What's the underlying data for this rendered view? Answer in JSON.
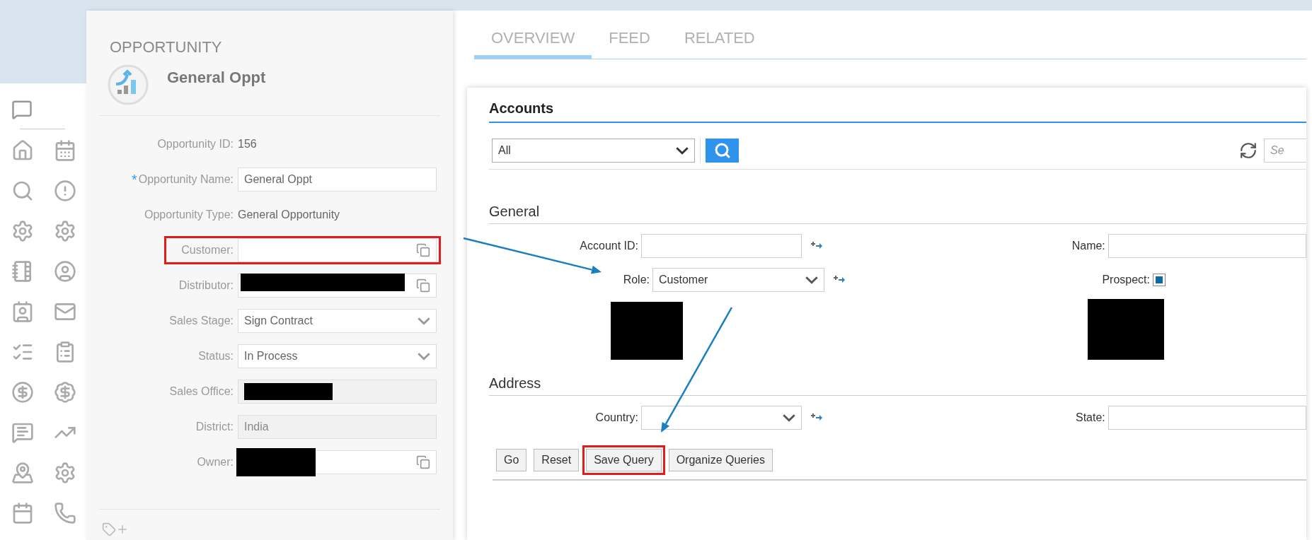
{
  "record": {
    "type_label": "OPPORTUNITY",
    "name": "General Oppt"
  },
  "required_marker": "*",
  "fields": [
    {
      "label": "Opportunity ID:",
      "kind": "text",
      "value": "156",
      "required": false,
      "redacted": false,
      "highlighted": false
    },
    {
      "label": "Opportunity Name:",
      "kind": "input",
      "value": "General Oppt",
      "required": true,
      "redacted": false,
      "highlighted": false
    },
    {
      "label": "Opportunity Type:",
      "kind": "text",
      "value": "General Opportunity",
      "required": false,
      "redacted": false,
      "highlighted": false
    },
    {
      "label": "Customer:",
      "kind": "lookup",
      "required": false,
      "redacted": false,
      "highlighted": true
    },
    {
      "label": "Distributor:",
      "kind": "lookup",
      "required": false,
      "redacted": true,
      "highlighted": false
    },
    {
      "label": "Sales Stage:",
      "kind": "select",
      "value": "Sign Contract",
      "required": false,
      "redacted": false,
      "highlighted": false
    },
    {
      "label": "Status:",
      "kind": "select",
      "value": "In Process",
      "required": false,
      "redacted": false,
      "highlighted": false
    },
    {
      "label": "Sales Office:",
      "kind": "readonly",
      "required": false,
      "redacted": true,
      "highlighted": false
    },
    {
      "label": "District:",
      "kind": "readonly",
      "value": "India",
      "required": false,
      "redacted": false,
      "highlighted": false
    },
    {
      "label": "Owner:",
      "kind": "lookup",
      "required": false,
      "redacted": true,
      "highlighted": false
    }
  ],
  "tabs": [
    {
      "label": "OVERVIEW",
      "selected": true
    },
    {
      "label": "FEED",
      "selected": false
    },
    {
      "label": "RELATED",
      "selected": false
    }
  ],
  "accounts": {
    "title": "Accounts",
    "filter": "All",
    "search": {
      "placeholder": "Se"
    },
    "sections": [
      {
        "title": "General",
        "redacted": true,
        "rows": [
          {
            "left": {
              "label": "Account ID:",
              "kind": "input"
            },
            "right": {
              "label": "Name:",
              "kind": "input"
            }
          },
          {
            "left": {
              "label": "Role:",
              "kind": "select",
              "value": "Customer"
            },
            "right": {
              "label": "Prospect:",
              "kind": "checkbox",
              "checked": true
            }
          }
        ]
      },
      {
        "title": "Address",
        "redacted": false,
        "rows": [
          {
            "left": {
              "label": "Country:",
              "kind": "select"
            },
            "right": {
              "label": "State:",
              "kind": "input"
            }
          }
        ]
      }
    ],
    "buttons": [
      {
        "label": "Go",
        "highlighted": false
      },
      {
        "label": "Reset",
        "highlighted": false
      },
      {
        "label": "Save Query",
        "highlighted": true
      },
      {
        "label": "Organize Queries",
        "highlighted": false
      }
    ]
  }
}
